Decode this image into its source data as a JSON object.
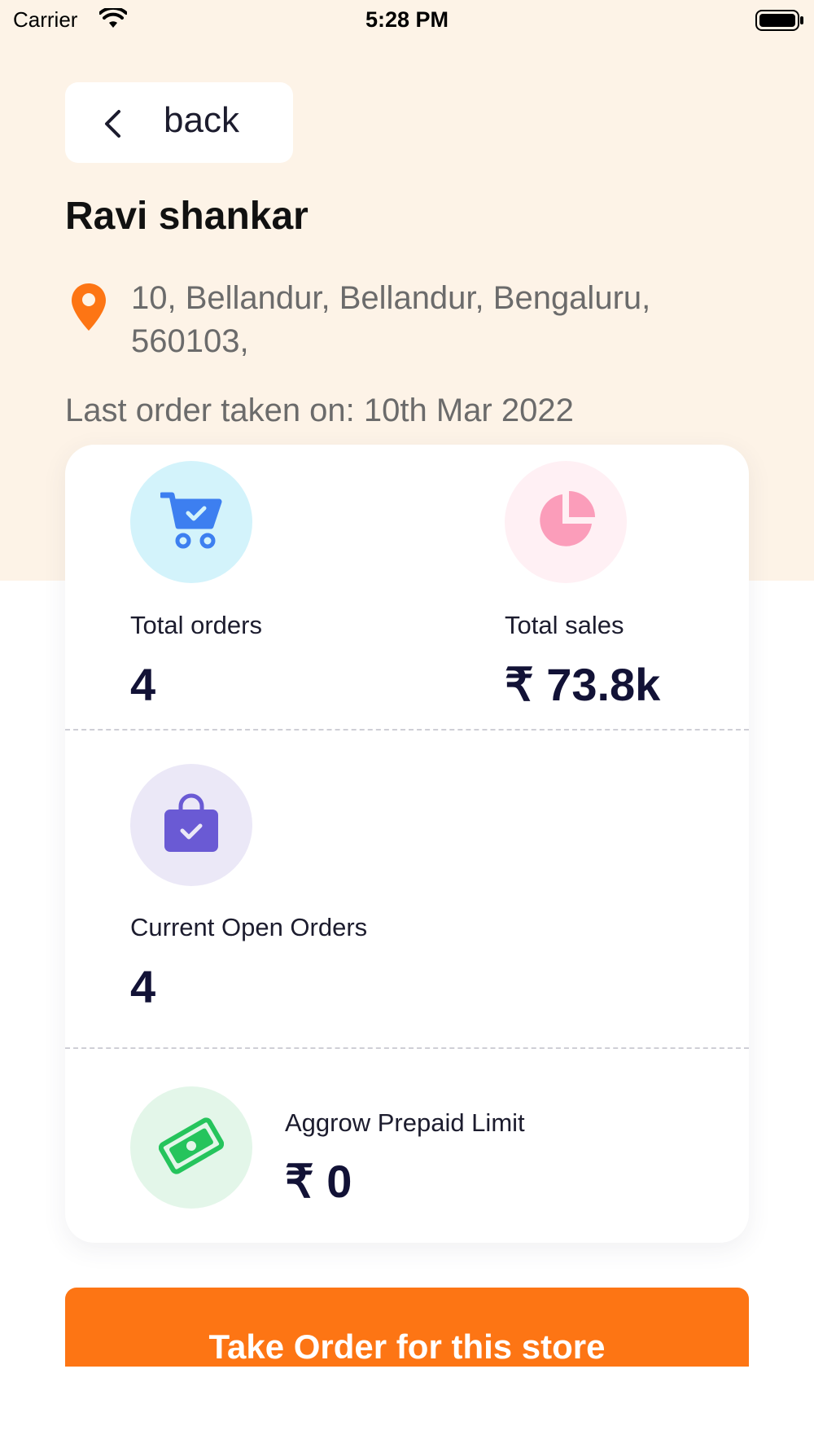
{
  "status_bar": {
    "carrier": "Carrier",
    "time": "5:28 PM"
  },
  "header": {
    "back_label": "back",
    "store_name": "Ravi shankar",
    "address": " 10, Bellandur, Bellandur, Bengaluru, 560103,",
    "last_order": "Last order taken on: 10th Mar 2022"
  },
  "stats": {
    "total_orders": {
      "label": "Total orders",
      "value": "4",
      "icon": "cart-icon",
      "icon_bg": "#d3f3fb",
      "icon_color": "#3d7ff0"
    },
    "total_sales": {
      "label": "Total sales",
      "value": "₹ 73.8k",
      "icon": "pie-chart-icon",
      "icon_bg": "#fff0f4",
      "icon_color": "#fb9dba"
    },
    "open_orders": {
      "label": "Current Open Orders",
      "value": "4",
      "icon": "shopping-bag-icon",
      "icon_bg": "#ebe8f7",
      "icon_color": "#6a5ad4"
    },
    "prepaid_limit": {
      "label": "Aggrow Prepaid Limit",
      "value": "₹ 0",
      "icon": "money-icon",
      "icon_bg": "#e3f6e9",
      "icon_color": "#25c45c"
    }
  },
  "cta": {
    "label": "Take Order for this store",
    "color": "#fd7514"
  },
  "colors": {
    "top_background": "#fdf3e7",
    "pin": "#fd7514"
  }
}
